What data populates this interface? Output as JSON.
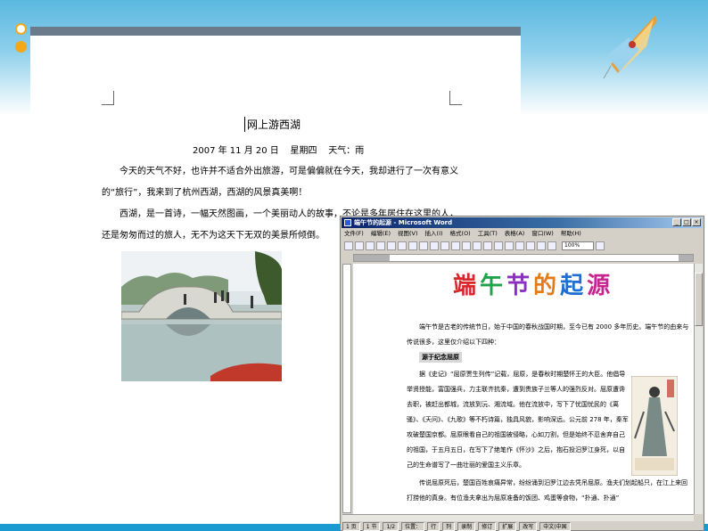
{
  "doc1": {
    "title": "网上游西湖",
    "date_line": "2007 年 11 月 20 日    星期四    天气：雨",
    "paragraphs": [
      "今天的天气不好，也许并不适合外出旅游，可是偏偏就在今天，我却进行了一次有意义的“旅行”，我来到了杭州西湖，西湖的风景真美啊！",
      "西湖，是一首诗，一幅天然图画，一个美丽动人的故事，不论是多年居住在这里的人，还是匆匆而过的旅人，无不为这天下无双的美景所倾倒。"
    ]
  },
  "word": {
    "title": "端午节的起源 - Microsoft Word",
    "menu": [
      "文件(F)",
      "编辑(E)",
      "视图(V)",
      "插入(I)",
      "格式(O)",
      "工具(T)",
      "表格(A)",
      "窗口(W)",
      "帮助(H)"
    ],
    "zoom": "100%",
    "wordart_chars": [
      "端",
      "午",
      "节",
      "的",
      "起",
      "源"
    ],
    "intro": "端午节是古老的传统节日，始于中国的春秋战国时期，至今已有 2000 多年历史。端午节的由来与传说很多，这里仅介绍以下四种：",
    "subheading": "源于纪念屈原",
    "body1": "据《史记》“屈原贾生列传”记载，屈原，是春秋时期楚怀王的大臣。他倡导举贤授能，富国强兵，力主联齐抗秦，遭到贵族子兰等人的强烈反对。屈原遭谗去职，被赶出都城，流放到沅、湘流域。他在流放中，写下了忧国忧民的《离骚》、《天问》、《九歌》等不朽诗篇，独具风貌，影响深远。公元前 278 年，秦军攻破楚国京都。屈原眼看自己的祖国被侵略，心如刀割，但是始终不忍舍弃自己的祖国，于五月五日，在写下了绝笔作《怀沙》之后，抱石投汨罗江身死，以自己的生命谱写了一曲壮丽的爱国主义乐章。",
    "body2": "传说屈原死后，楚国百姓哀痛异常，纷纷涌到汨罗江边去凭吊屈原。渔夫们划起船只，在江上来回打捞他的真身。有位渔夫拿出为屈原准备的饭团、鸡蛋等食物，“扑通、扑通”",
    "status": [
      "1 页",
      "1 节",
      "1/2",
      "位置：",
      "行",
      "列",
      "录制",
      "修订",
      "扩展",
      "改写",
      "中文(中国"
    ]
  },
  "colors": {
    "accent_orange": "#f2a81a",
    "sky_blue": "#5ab8e0",
    "word_titlebar": "#0a246a"
  }
}
